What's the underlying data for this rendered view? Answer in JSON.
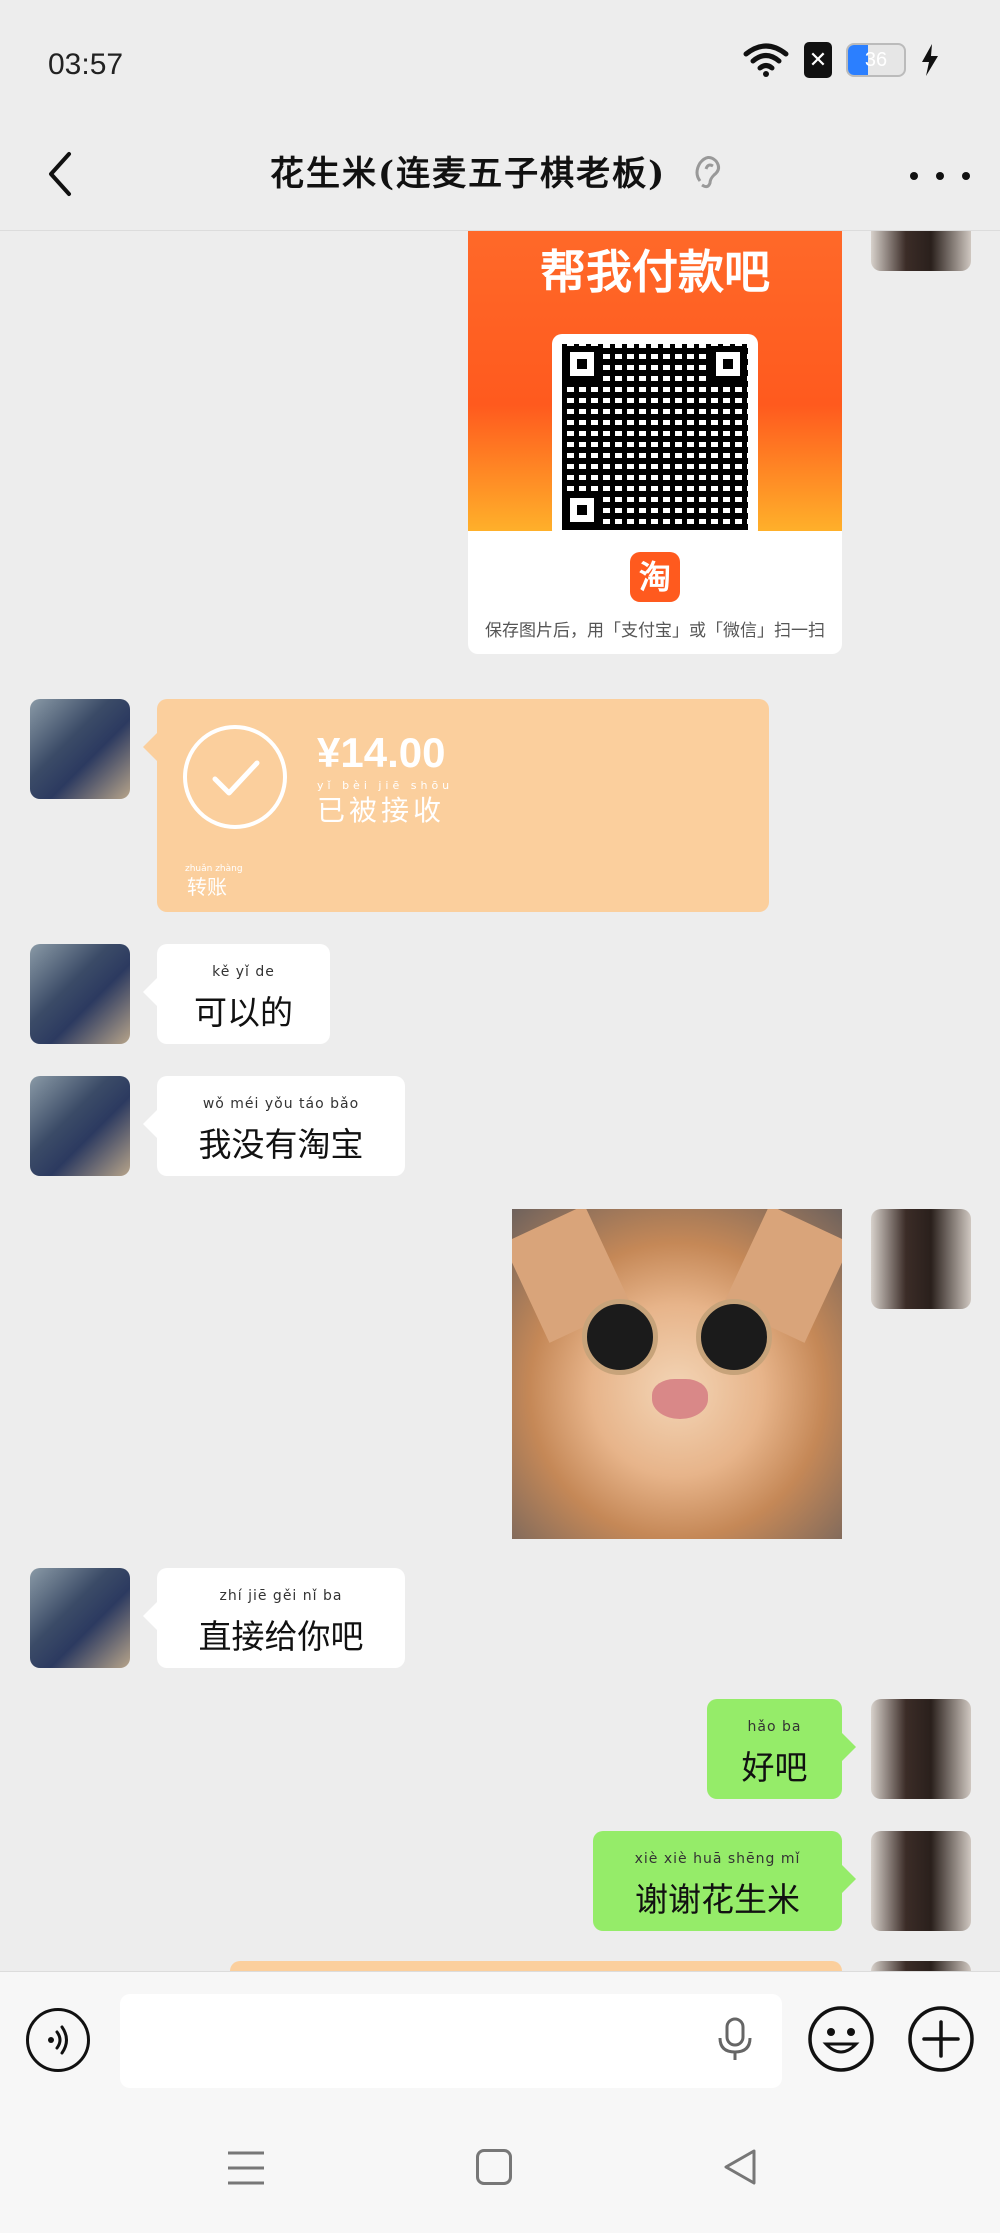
{
  "status_bar": {
    "time": "03:57",
    "battery": "36",
    "sim_label": "✕"
  },
  "header": {
    "title": "花生米(连麦五子棋老板)",
    "back_icon": "back-chevron-icon",
    "more_icon": "more-dots-icon",
    "ear_icon": "earpiece-icon"
  },
  "messages": {
    "pay_card": {
      "title": "帮我付款吧",
      "app_logo": "淘",
      "footer": "保存图片后，用「支付宝」或「微信」扫一扫"
    },
    "transfer": {
      "amount": "¥14.00",
      "status": "已被接收",
      "status_pinyin": "yǐ bèi jiē shōu",
      "label": "转账",
      "label_pinyin": "zhuǎn zhàng"
    },
    "msg1": {
      "text": "可以的",
      "pinyin": "kě yǐ de"
    },
    "msg2": {
      "text": "我没有淘宝",
      "pinyin": "wǒ méi yǒu táo bǎo"
    },
    "msg3": {
      "text": "直接给你吧",
      "pinyin": "zhí jiē gěi nǐ ba"
    },
    "msg4": {
      "text": "好吧",
      "pinyin": "hǎo ba"
    },
    "msg5": {
      "text": "谢谢花生米",
      "pinyin": "xiè xiè huā shēng mǐ"
    }
  },
  "input_bar": {
    "placeholder": "",
    "voice_icon": "voice-input-icon",
    "mic_icon": "microphone-icon",
    "emoji_icon": "emoji-icon",
    "plus_icon": "plus-icon"
  },
  "colors": {
    "background": "#ededed",
    "green_bubble": "#95ec69",
    "transfer_card": "#fbcf9d",
    "pay_card_top": "#ff5a1e",
    "battery_fill": "#2b7fff"
  }
}
